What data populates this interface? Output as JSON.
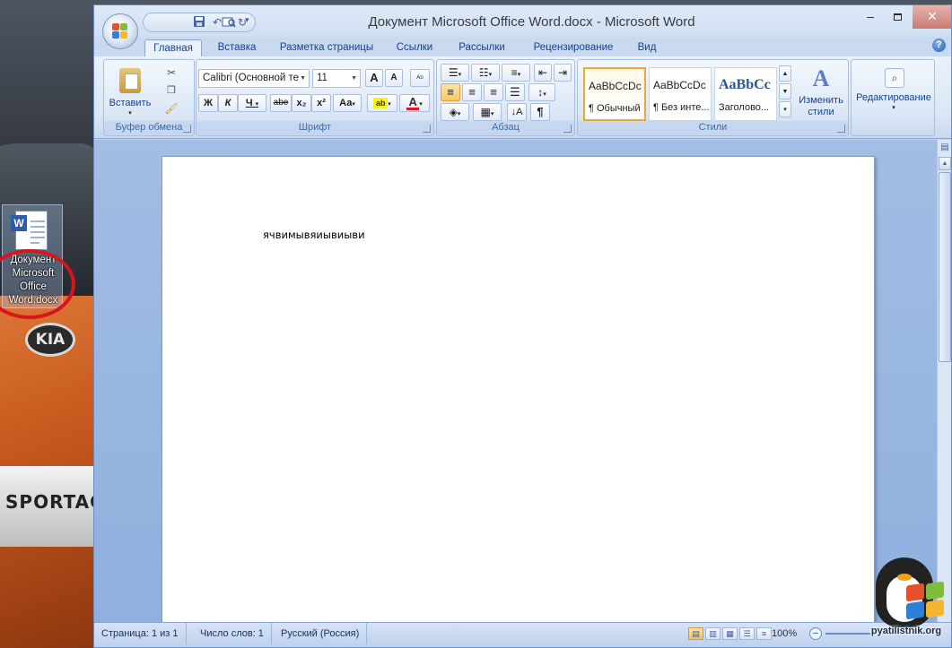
{
  "desktop": {
    "icon_label": "Документ Microsoft Office Word.docx",
    "car_brand": "KIA",
    "car_model": "SPORTAG"
  },
  "window": {
    "title": "Документ Microsoft Office Word.docx - Microsoft Word",
    "controls": {
      "minimize": "–",
      "close": "✕"
    }
  },
  "quick_access": {
    "save_icon": "save-icon",
    "undo_icon": "undo-icon",
    "redo_icon": "redo-icon",
    "print_preview_icon": "print-preview-icon"
  },
  "tabs": [
    {
      "label": "Главная",
      "active": true
    },
    {
      "label": "Вставка"
    },
    {
      "label": "Разметка страницы"
    },
    {
      "label": "Ссылки"
    },
    {
      "label": "Рассылки"
    },
    {
      "label": "Рецензирование"
    },
    {
      "label": "Вид"
    }
  ],
  "ribbon": {
    "clipboard": {
      "label": "Буфер обмена",
      "paste": "Вставить"
    },
    "font": {
      "label": "Шрифт",
      "font_name": "Calibri (Основной те",
      "font_size": "11",
      "bold": "Ж",
      "italic": "К",
      "underline": "Ч",
      "strike": "abe",
      "subscript": "x₂",
      "superscript": "x²",
      "change_case": "Аа",
      "grow": "A",
      "shrink": "A"
    },
    "paragraph": {
      "label": "Абзац"
    },
    "styles": {
      "label": "Стили",
      "items": [
        {
          "preview": "AaBbCcDc",
          "name": "¶ Обычный"
        },
        {
          "preview": "AaBbCcDc",
          "name": "¶ Без инте..."
        },
        {
          "preview": "AaBbCc",
          "name": "Заголово..."
        }
      ],
      "change_styles": "Изменить стили"
    },
    "editing": {
      "label": "Редактирование"
    }
  },
  "document": {
    "text": "ячвимывяиывиыви"
  },
  "statusbar": {
    "page": "Страница: 1 из 1",
    "words": "Число слов: 1",
    "language": "Русский (Россия)",
    "zoom": "100%"
  },
  "watermark": {
    "text": "pyatilistnik.org"
  },
  "colors": {
    "accent": "#15428b",
    "ribbon": "#dbe7f6",
    "doc_bg": "#8fb0de"
  }
}
